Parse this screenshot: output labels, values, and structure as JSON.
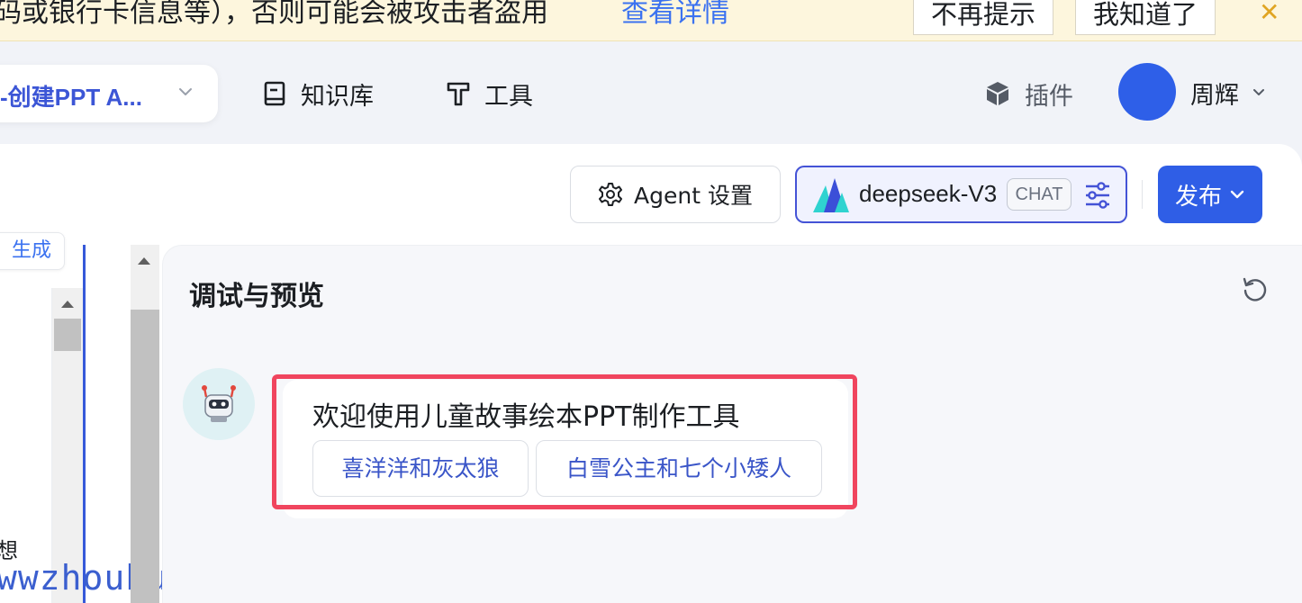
{
  "banner": {
    "text": "码或银行卡信息等），否则可能会被攻击者盗用",
    "link": "查看详情",
    "dismiss_label": "不再提示",
    "ack_label": "我知道了",
    "close_glyph": "✕"
  },
  "header": {
    "app_name": "-创建PPT A...",
    "nav": [
      {
        "label": "知识库",
        "icon": "book-icon"
      },
      {
        "label": "工具",
        "icon": "hammer-icon"
      }
    ],
    "plugin_label": "插件",
    "user_name": "周辉"
  },
  "toolbar": {
    "agent_settings_label": "Agent 设置",
    "model_name": "deepseek-V3",
    "model_badge": "CHAT",
    "publish_label": "发布"
  },
  "left_panel": {
    "generate_chip": "生成",
    "partial_text": "想",
    "watermark": "wwzhouhui"
  },
  "preview": {
    "title": "调试与预览",
    "welcome_message": "欢迎使用儿童故事绘本PPT制作工具",
    "suggestions": [
      "喜洋洋和灰太狼",
      "白雪公主和七个小矮人"
    ]
  },
  "colors": {
    "accent": "#2f5ee6",
    "banner_bg": "#fdf6dd",
    "highlight": "#f0455e",
    "model_border": "#4453d6"
  }
}
